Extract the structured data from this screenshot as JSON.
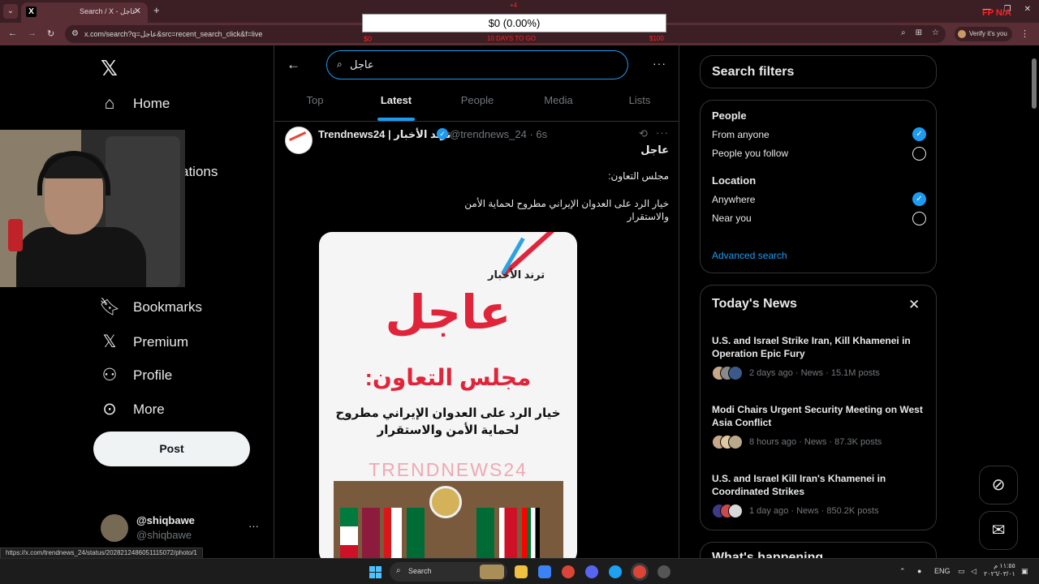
{
  "browser": {
    "tab_title": "Search / X - عاجل",
    "tab_close": "✕",
    "new_tab": "+",
    "url": "x.com/search?q=عاجل&src=recent_search_click&f=live",
    "verify_label": "Verify it's you",
    "window_minimize": "—",
    "window_maximize": "❐",
    "window_close": "✕"
  },
  "overlay": {
    "value": "$0 (0.00%)",
    "top_label": "+4",
    "left_label": "$0",
    "mid_label": "10 DAYS TO GO",
    "right_label": "$100",
    "fp_label": "FP N/A"
  },
  "sidebar": {
    "logo": "𝕏",
    "items": [
      {
        "label": "Home",
        "icon": "home-icon"
      },
      {
        "label": "Bookmarks",
        "icon": "bookmark-icon"
      },
      {
        "label": "Premium",
        "icon": "x-premium-icon"
      },
      {
        "label": "Profile",
        "icon": "profile-icon"
      },
      {
        "label": "More",
        "icon": "more-circle-icon"
      }
    ],
    "occluded_fragment": "ations",
    "post_label": "Post",
    "account": {
      "name": "@shiqbawe",
      "handle": "@shiqbawe",
      "more": "···"
    }
  },
  "main": {
    "search_value": "عاجل",
    "tabs": [
      "Top",
      "Latest",
      "People",
      "Media",
      "Lists"
    ],
    "active_tab": "Latest",
    "tweet": {
      "name": "Trendnews24 | ترند الأخبار",
      "handle": "@trendnews_24 · 6s",
      "line1": "عاجل",
      "line2": "مجلس التعاون:",
      "line3": "خيار الرد على العدوان الإيراني مطروح لحماية الأمن والاستقرار",
      "image": {
        "brand": "ترند الأخبار",
        "headline": "عاجل",
        "subheadline": "مجلس التعاون:",
        "body": "خيار الرد على العدوان الإيراني مطروح لحماية الأمن والاستقرار",
        "watermark": "TRENDNEWS24"
      }
    }
  },
  "filters": {
    "title": "Search filters",
    "people_heading": "People",
    "people_options": [
      "From anyone",
      "People you follow"
    ],
    "people_selected": 0,
    "location_heading": "Location",
    "location_options": [
      "Anywhere",
      "Near you"
    ],
    "location_selected": 0,
    "advanced_label": "Advanced search"
  },
  "news": {
    "title": "Today's News",
    "items": [
      {
        "title": "U.S. and Israel Strike Iran, Kill Khamenei in Operation Epic Fury",
        "meta": "2 days ago · News · 15.1M posts"
      },
      {
        "title": "Modi Chairs Urgent Security Meeting on West Asia Conflict",
        "meta": "8 hours ago · News · 87.3K posts"
      },
      {
        "title": "U.S. and Israel Kill Iran's Khamenei in Coordinated Strikes",
        "meta": "1 day ago · News · 850.2K posts"
      }
    ],
    "next_card_title": "What's happening"
  },
  "status_url": "https://x.com/trendnews_24/status/2028212486051115072/photo/1",
  "taskbar": {
    "search_label": "Search",
    "lang": "ENG",
    "time": "١١:٥٥ م",
    "date": "٢٠٢٦/٠٣/٠١"
  },
  "colors": {
    "accent": "#1d9bf0",
    "browser_chrome": "#5a2e35",
    "alert_red": "#e0243a"
  }
}
